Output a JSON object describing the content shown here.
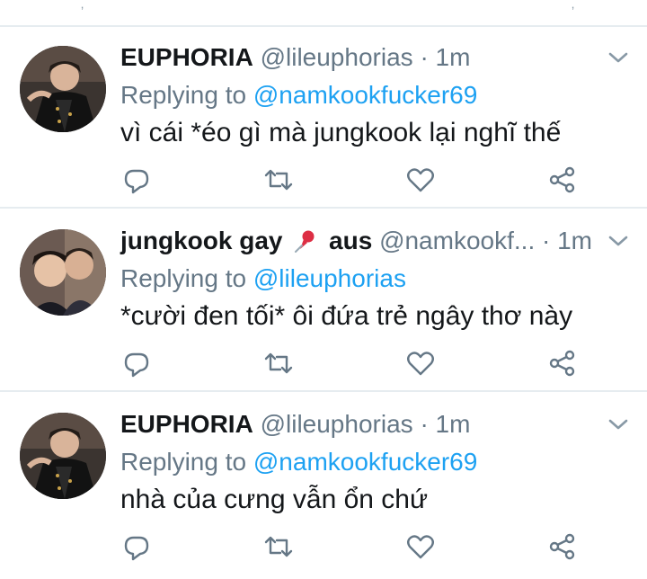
{
  "top_marks": [
    "‚",
    "‚"
  ],
  "tweets": [
    {
      "name": "EUPHORIA",
      "handle": "@lileuphorias",
      "dot": "·",
      "time": "1m",
      "reply_prefix": "Replying to",
      "reply_to": "@namkookfucker69",
      "text": "vì cái *éo gì mà jungkook lại nghĩ thế",
      "avatar": "avatar-photo-1"
    },
    {
      "name": "jungkook gay",
      "pin": "pushpin-emoji",
      "name_suffix": "aus",
      "handle": "@namkookf...",
      "dot": "·",
      "time": "1m",
      "reply_prefix": "Replying to",
      "reply_to": "@lileuphorias",
      "text": "*cười đen tối* ôi đứa trẻ ngây thơ này",
      "avatar": "avatar-photo-2"
    },
    {
      "name": "EUPHORIA",
      "handle": "@lileuphorias",
      "dot": "·",
      "time": "1m",
      "reply_prefix": "Replying to",
      "reply_to": "@namkookfucker69",
      "text": "nhà của cưng vẫn ổn chứ",
      "avatar": "avatar-photo-1"
    }
  ],
  "icons": [
    "reply-icon",
    "retweet-icon",
    "like-icon",
    "share-icon",
    "chevron-down-icon"
  ],
  "colors": {
    "link": "#1da1f2",
    "muted": "#657786",
    "text": "#14171a",
    "divider": "#e6ecf0"
  }
}
